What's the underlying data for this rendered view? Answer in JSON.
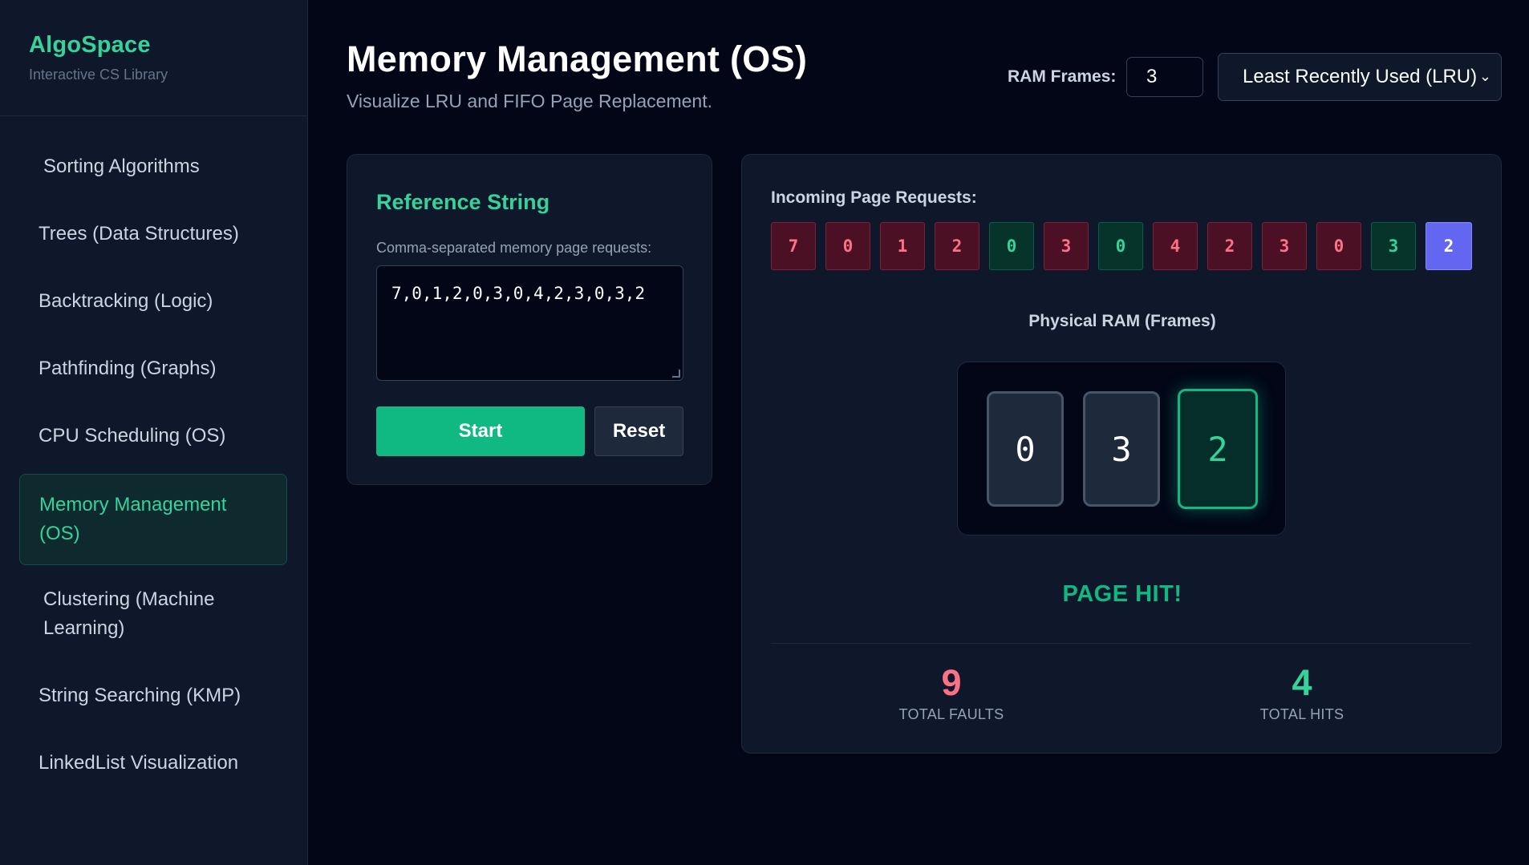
{
  "sidebar": {
    "brand_title": "AlgoSpace",
    "brand_subtitle": "Interactive CS Library",
    "items": [
      {
        "label": "Sorting Algorithms",
        "active": false
      },
      {
        "label": "Trees (Data Structures)",
        "active": false
      },
      {
        "label": "Backtracking (Logic)",
        "active": false
      },
      {
        "label": "Pathfinding (Graphs)",
        "active": false
      },
      {
        "label": "CPU Scheduling (OS)",
        "active": false
      },
      {
        "label": "Memory Management (OS)",
        "active": true
      },
      {
        "label": "Clustering (Machine Learning)",
        "active": false
      },
      {
        "label": "String Searching (KMP)",
        "active": false
      },
      {
        "label": "LinkedList Visualization",
        "active": false
      }
    ]
  },
  "header": {
    "title": "Memory Management (OS)",
    "subtitle": "Visualize LRU and FIFO Page Replacement.",
    "frames_label": "RAM Frames:",
    "frames_value": "3",
    "algorithm_selected": "Least Recently Used (LRU)"
  },
  "reference": {
    "title": "Reference String",
    "label": "Comma-separated memory page requests:",
    "value": "7,0,1,2,0,3,0,4,2,3,0,3,2",
    "start_label": "Start",
    "reset_label": "Reset"
  },
  "visualization": {
    "requests_label": "Incoming Page Requests:",
    "requests": [
      {
        "page": "7",
        "state": "fault"
      },
      {
        "page": "0",
        "state": "fault"
      },
      {
        "page": "1",
        "state": "fault"
      },
      {
        "page": "2",
        "state": "fault"
      },
      {
        "page": "0",
        "state": "hit"
      },
      {
        "page": "3",
        "state": "fault"
      },
      {
        "page": "0",
        "state": "hit"
      },
      {
        "page": "4",
        "state": "fault"
      },
      {
        "page": "2",
        "state": "fault"
      },
      {
        "page": "3",
        "state": "fault"
      },
      {
        "page": "0",
        "state": "fault"
      },
      {
        "page": "3",
        "state": "hit"
      },
      {
        "page": "2",
        "state": "current"
      }
    ],
    "ram_label": "Physical RAM (Frames)",
    "frames": [
      {
        "page": "0",
        "highlight": false
      },
      {
        "page": "3",
        "highlight": false
      },
      {
        "page": "2",
        "highlight": true
      }
    ],
    "status": "PAGE HIT!",
    "total_faults": "9",
    "total_faults_label": "TOTAL FAULTS",
    "total_hits": "4",
    "total_hits_label": "TOTAL HITS"
  },
  "colors": {
    "accent": "#34d399",
    "fault": "#fb7185",
    "current": "#6366f1",
    "background": "#020617",
    "panel": "#0f172a"
  }
}
